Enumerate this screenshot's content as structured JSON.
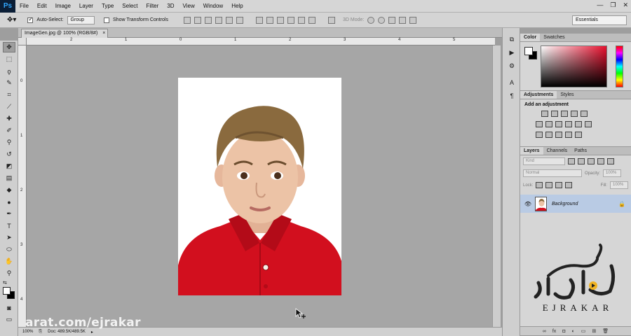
{
  "app": {
    "logo": "Ps"
  },
  "menu": [
    "File",
    "Edit",
    "Image",
    "Layer",
    "Type",
    "Select",
    "Filter",
    "3D",
    "View",
    "Window",
    "Help"
  ],
  "window_controls": [
    "—",
    "❐",
    "✕"
  ],
  "options": {
    "auto_select_label": "Auto-Select:",
    "auto_select_value": "Group",
    "transform_label": "Show Transform Controls",
    "mode_3d": "3D Mode:",
    "workspace": "Essentials"
  },
  "document": {
    "tab_title": "ImageGen.jpg @ 100% (RGB/8#)",
    "tab_close": "×",
    "zoom": "100%",
    "doc_size": "Doc: 489.5K/489.5K"
  },
  "rulers": {
    "h_ticks": [
      "2",
      "1",
      "0",
      "1",
      "2",
      "3",
      "4",
      "5"
    ],
    "v_ticks": [
      "0",
      "1",
      "2",
      "3",
      "4"
    ]
  },
  "panels": {
    "color_tabs": [
      "Color",
      "Swatches"
    ],
    "adjust_tabs": [
      "Adjustments",
      "Styles"
    ],
    "adjust_title": "Add an adjustment",
    "layers_tabs": [
      "Layers",
      "Channels",
      "Paths"
    ],
    "kind_filter": "Kind",
    "blend_mode": "Normal",
    "opacity_label": "Opacity:",
    "opacity_value": "100%",
    "lock_label": "Lock:",
    "fill_label": "Fill:",
    "fill_value": "100%",
    "layer_name": "Background"
  },
  "watermark": {
    "url": "arat.com/ejrakar",
    "brand_latin": "EJRAKAR",
    "brand_arabic": "اجراکار"
  },
  "colors": {
    "shirt": "#d20f1e",
    "hair": "#8a6a3e",
    "skin": "#ecc3a6",
    "layer_selected": "#b9cbe4"
  }
}
